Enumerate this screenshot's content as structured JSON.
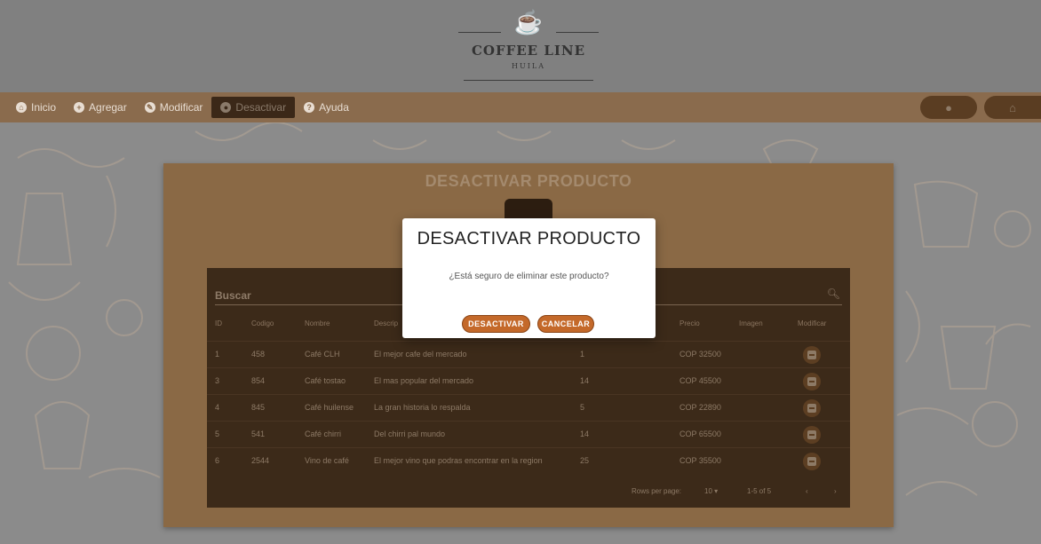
{
  "logo": {
    "name": "COFFEE LINE",
    "subtitle": "HUILA"
  },
  "nav": {
    "items": [
      {
        "label": "Inicio",
        "icon": "home-icon"
      },
      {
        "label": "Agregar",
        "icon": "plus-circle-icon"
      },
      {
        "label": "Modificar",
        "icon": "pencil-icon"
      },
      {
        "label": "Desactivar",
        "icon": "toggle-icon"
      },
      {
        "label": "Ayuda",
        "icon": "help-icon"
      }
    ],
    "right": {
      "user_icon": "user-icon",
      "home_icon": "home-icon"
    }
  },
  "panel": {
    "title": "DESACTIVAR PRODUCTO"
  },
  "table": {
    "search_label": "Buscar",
    "columns": [
      "ID",
      "Codigo",
      "Nombre",
      "Descrip",
      "Precio",
      "Imagen",
      "Modificar"
    ],
    "rows": [
      {
        "id": "1",
        "codigo": "458",
        "nombre": "Café CLH",
        "descripcion": "El mejor cafe del mercado",
        "cantidad": "1",
        "precio": "COP 32500"
      },
      {
        "id": "3",
        "codigo": "854",
        "nombre": "Café tostao",
        "descripcion": "El mas popular del mercado",
        "cantidad": "14",
        "precio": "COP 45500"
      },
      {
        "id": "4",
        "codigo": "845",
        "nombre": "Café huilense",
        "descripcion": "La gran historia lo respalda",
        "cantidad": "5",
        "precio": "COP 22890"
      },
      {
        "id": "5",
        "codigo": "541",
        "nombre": "Café chirri",
        "descripcion": "Del chirri pal mundo",
        "cantidad": "14",
        "precio": "COP 65500"
      },
      {
        "id": "6",
        "codigo": "2544",
        "nombre": "Vino de café",
        "descripcion": "El mejor vino que podras encontrar en la region",
        "cantidad": "25",
        "precio": "COP 35500"
      }
    ],
    "footer": {
      "rows_per_page_label": "Rows per page:",
      "rows_per_page": "10",
      "range": "1-5 of 5"
    }
  },
  "modal": {
    "title": "DESACTIVAR PRODUCTO",
    "message": "¿Está seguro de eliminar este producto?",
    "confirm_label": "DESACTIVAR",
    "cancel_label": "CANCELAR"
  },
  "colors": {
    "accent": "#c4692a",
    "navbar": "#8a6b4d",
    "table": "#3c2a19"
  }
}
